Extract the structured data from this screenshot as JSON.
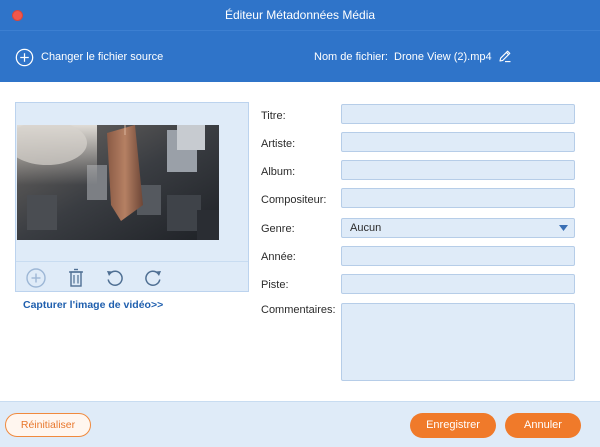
{
  "window": {
    "title": "Éditeur Métadonnées Média"
  },
  "toolbar": {
    "change_source_label": "Changer le fichier source",
    "filename_label": "Nom de fichier:",
    "filename_value": "Drone View (2).mp4"
  },
  "preview": {
    "capture_link": "Capturer l'image de vidéo>>",
    "controls": [
      "add-icon",
      "trash-icon",
      "rotate-left-icon",
      "rotate-right-icon"
    ]
  },
  "form": {
    "title_label": "Titre:",
    "artist_label": "Artiste:",
    "album_label": "Album:",
    "composer_label": "Compositeur:",
    "genre_label": "Genre:",
    "genre_value": "Aucun",
    "year_label": "Année:",
    "track_label": "Piste:",
    "comments_label": "Commentaires:",
    "title_value": "",
    "artist_value": "",
    "album_value": "",
    "composer_value": "",
    "year_value": "",
    "track_value": "",
    "comments_value": ""
  },
  "footer": {
    "reset_label": "Réinitialiser",
    "save_label": "Enregistrer",
    "cancel_label": "Annuler"
  },
  "colors": {
    "header_blue": "#2f74c9",
    "panel_blue": "#dfebf8",
    "accent_orange": "#f07a2a",
    "close_red": "#f2574b"
  }
}
